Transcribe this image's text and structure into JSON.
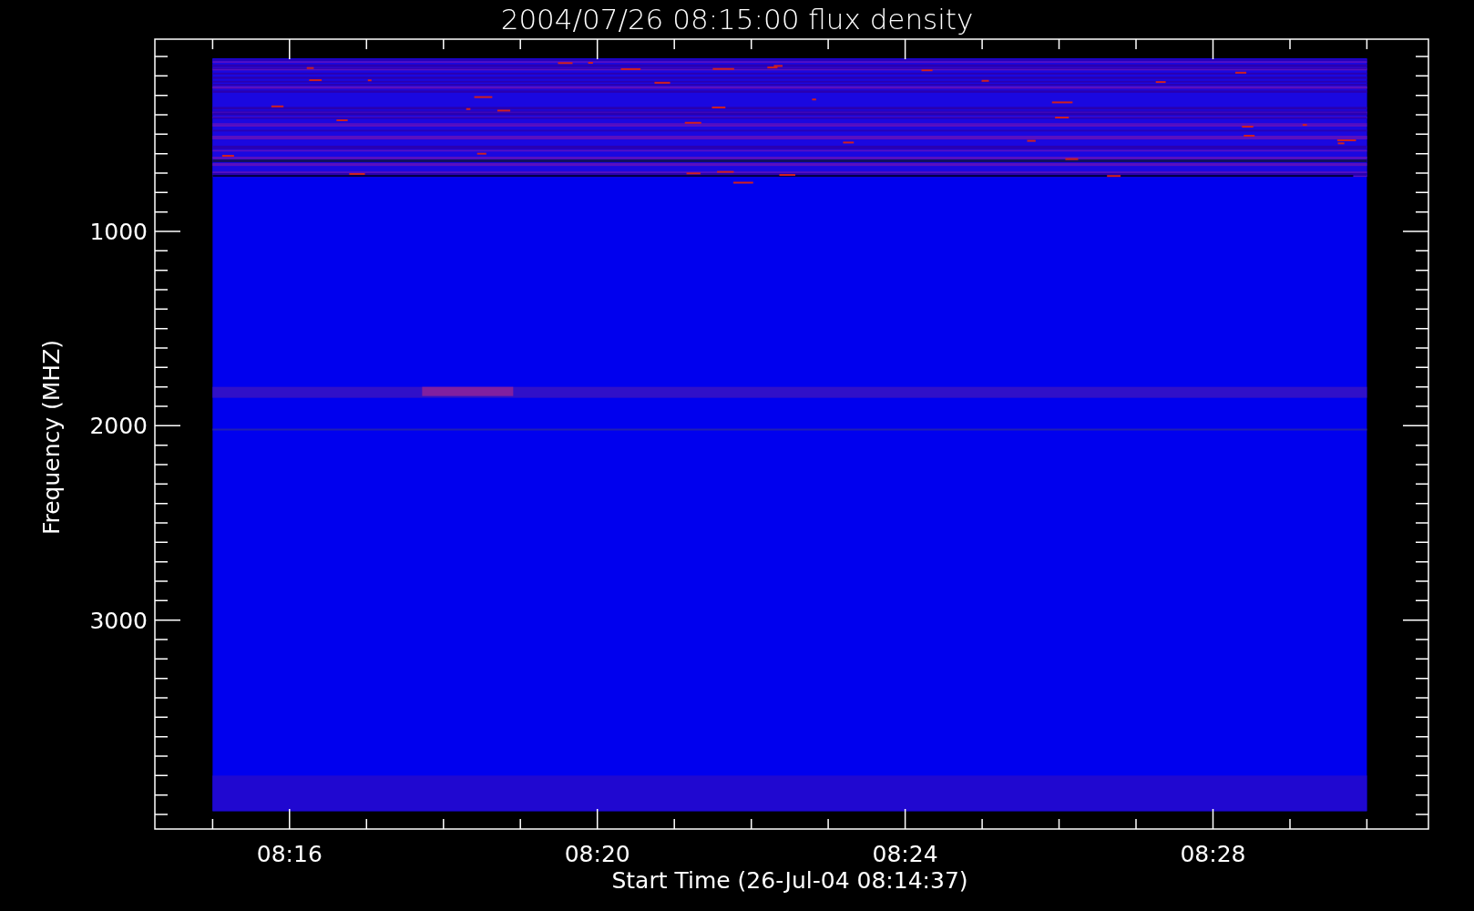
{
  "plot": {
    "title": "2004/07/26 08:15:00 flux density",
    "ylabel": "Frequency (MHZ)",
    "xlabel": "Start Time (26-Jul-04 08:14:37)",
    "yticks": [
      "1000",
      "2000",
      "3000"
    ],
    "xticks": [
      "08:16",
      "08:20",
      "08:24",
      "08:28"
    ]
  }
}
